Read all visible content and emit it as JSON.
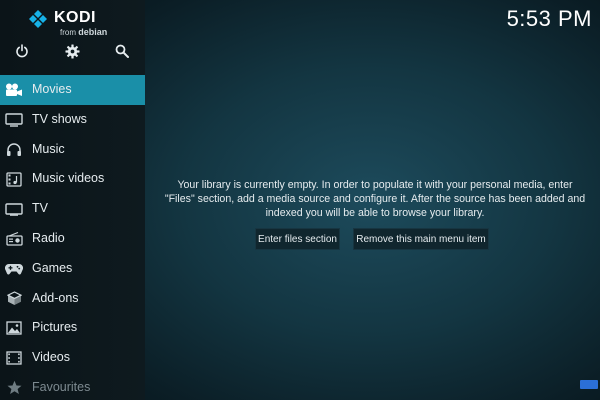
{
  "app": {
    "logo_text": "KODI",
    "logo_sub_from": "from",
    "logo_sub_brand": "debian",
    "clock": "5:53 PM"
  },
  "top_icons": [
    "power-icon",
    "gear-icon",
    "search-icon"
  ],
  "menu": {
    "items": [
      {
        "label": "Movies",
        "icon": "movie-camera-icon",
        "active": true
      },
      {
        "label": "TV shows",
        "icon": "monitor-icon"
      },
      {
        "label": "Music",
        "icon": "headphones-icon"
      },
      {
        "label": "Music videos",
        "icon": "music-video-icon"
      },
      {
        "label": "TV",
        "icon": "tv-icon"
      },
      {
        "label": "Radio",
        "icon": "radio-icon"
      },
      {
        "label": "Games",
        "icon": "gamepad-icon"
      },
      {
        "label": "Add-ons",
        "icon": "box-icon"
      },
      {
        "label": "Pictures",
        "icon": "picture-icon"
      },
      {
        "label": "Videos",
        "icon": "film-icon"
      },
      {
        "label": "Favourites",
        "icon": "star-icon",
        "dim": true
      }
    ]
  },
  "main": {
    "message_line1": "Your library is currently empty. In order to populate it with your personal media, enter",
    "message_line2": "\"Files\" section, add a media source and configure it. After the source has been added and",
    "message_line3": "indexed you will be able to browse your library.",
    "button_files": "Enter files section",
    "button_remove": "Remove this main menu item"
  },
  "colors": {
    "accent": "#1a8fa8",
    "sidebar_bg": "#0e1a1f",
    "button_bg": "#10262e"
  }
}
